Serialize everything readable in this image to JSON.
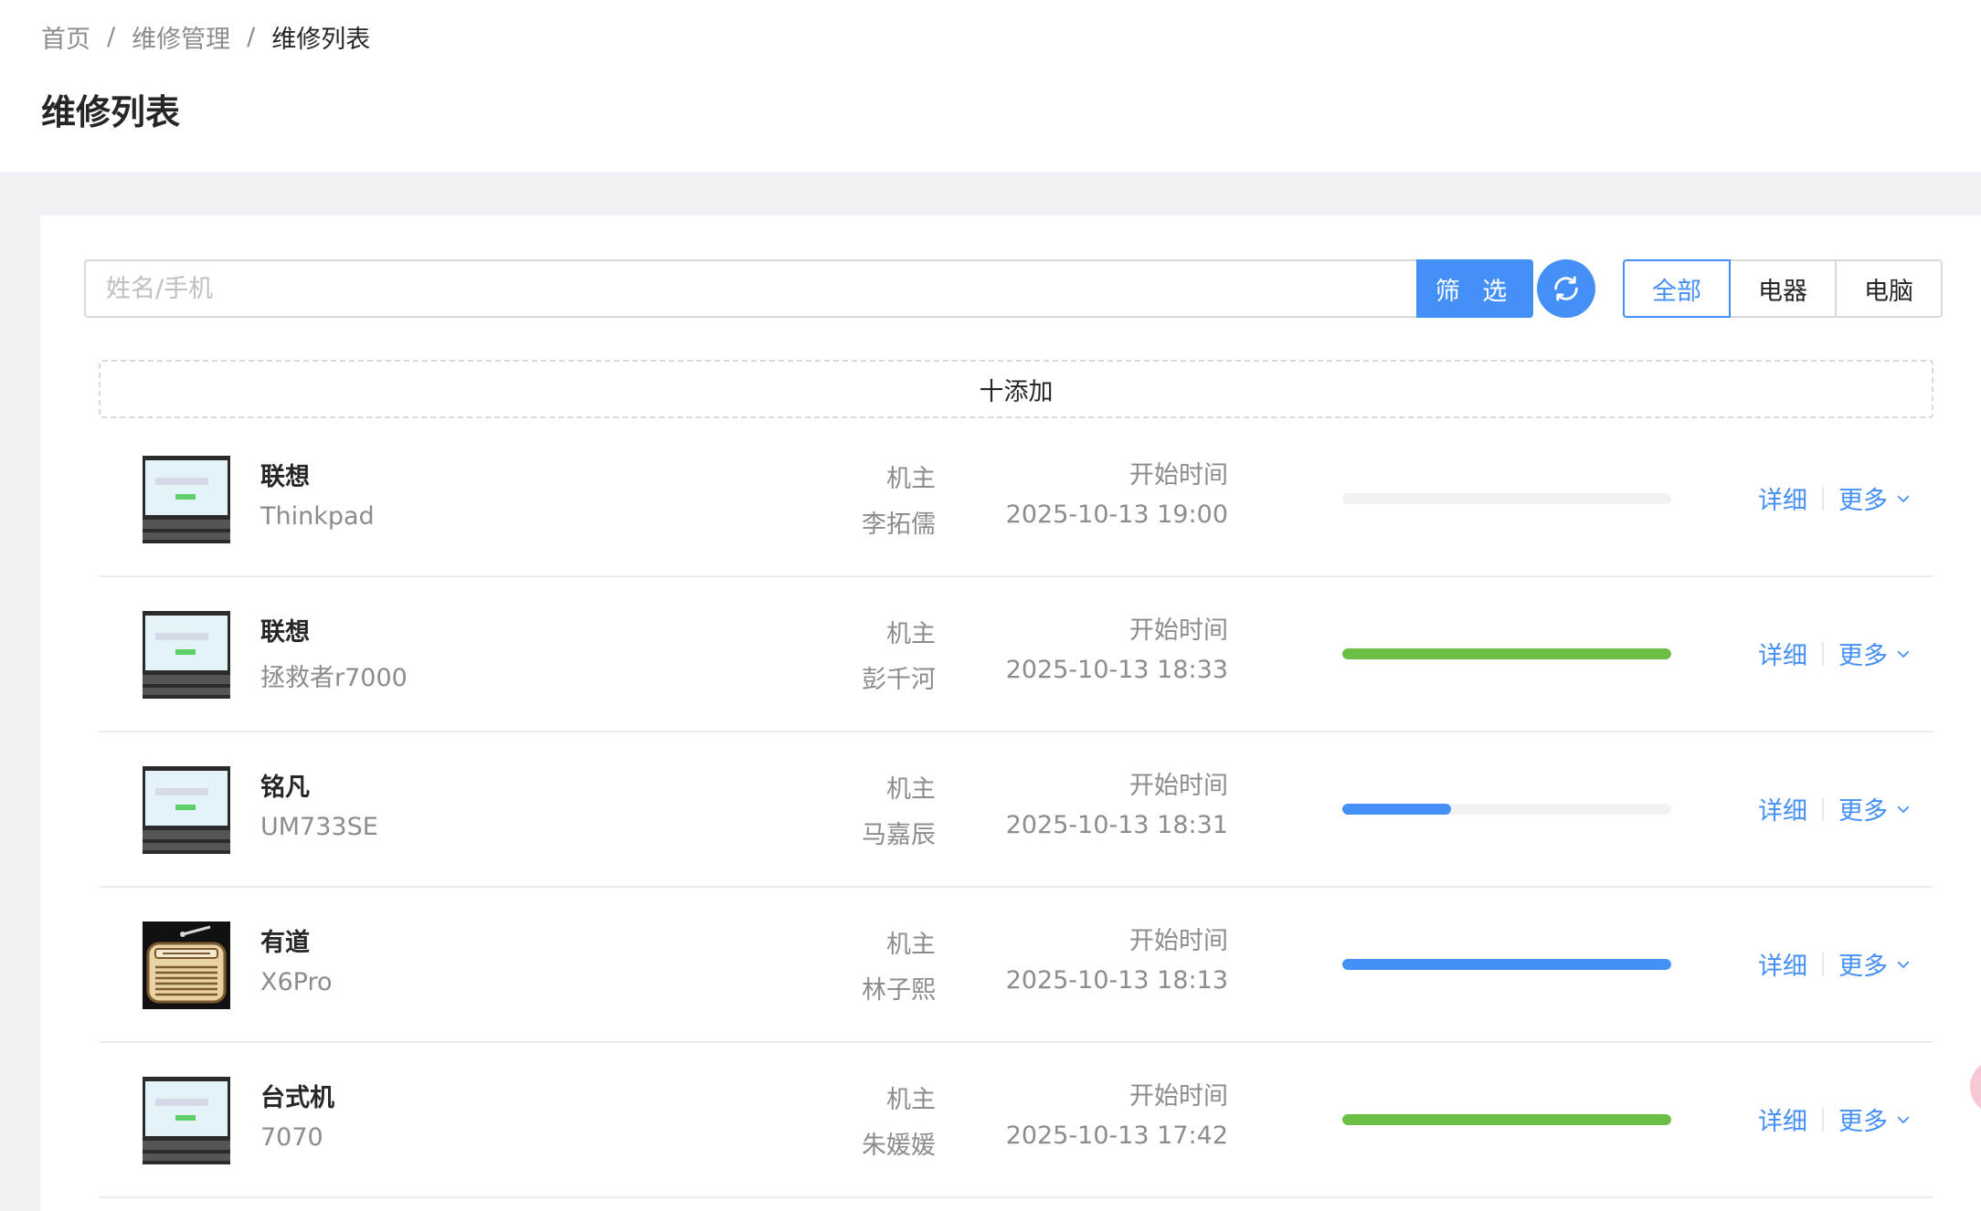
{
  "breadcrumb": {
    "items": [
      "首页",
      "维修管理",
      "维修列表"
    ],
    "separator": "/"
  },
  "page": {
    "title": "维修列表"
  },
  "toolbar": {
    "search_placeholder": "姓名/手机",
    "search_value": "",
    "filter_label": "筛 选",
    "refresh_icon": "refresh-icon",
    "segments": [
      {
        "label": "全部",
        "active": true
      },
      {
        "label": "电器",
        "active": false
      },
      {
        "label": "电脑",
        "active": false
      }
    ],
    "add_label": "十添加"
  },
  "colors": {
    "primary": "#4490f7",
    "success": "#6cbf45",
    "track": "#f2f2f2"
  },
  "records": [
    {
      "brand": "联想",
      "model": "Thinkpad",
      "owner_label": "机主",
      "owner": "李拓儒",
      "time_label": "开始时间",
      "start_time": "2025-10-13 19:00",
      "progress": 0,
      "progress_color": "#6cbf45",
      "icon": "laptop-icon",
      "detail_label": "详细",
      "more_label": "更多"
    },
    {
      "brand": "联想",
      "model": "拯救者r7000",
      "owner_label": "机主",
      "owner": "彭千河",
      "time_label": "开始时间",
      "start_time": "2025-10-13 18:33",
      "progress": 1.0,
      "progress_color": "#6cbf45",
      "icon": "laptop-icon",
      "detail_label": "详细",
      "more_label": "更多"
    },
    {
      "brand": "铭凡",
      "model": "UM733SE",
      "owner_label": "机主",
      "owner": "马嘉辰",
      "time_label": "开始时间",
      "start_time": "2025-10-13 18:31",
      "progress": 0.33,
      "progress_color": "#4490f7",
      "icon": "laptop-icon",
      "detail_label": "详细",
      "more_label": "更多"
    },
    {
      "brand": "有道",
      "model": "X6Pro",
      "owner_label": "机主",
      "owner": "林子熙",
      "time_label": "开始时间",
      "start_time": "2025-10-13 18:13",
      "progress": 1.0,
      "progress_color": "#4490f7",
      "icon": "radio-icon",
      "detail_label": "详细",
      "more_label": "更多"
    },
    {
      "brand": "台式机",
      "model": "7070",
      "owner_label": "机主",
      "owner": "朱媛媛",
      "time_label": "开始时间",
      "start_time": "2025-10-13 17:42",
      "progress": 1.0,
      "progress_color": "#6cbf45",
      "icon": "laptop-icon",
      "detail_label": "详细",
      "more_label": "更多"
    }
  ]
}
